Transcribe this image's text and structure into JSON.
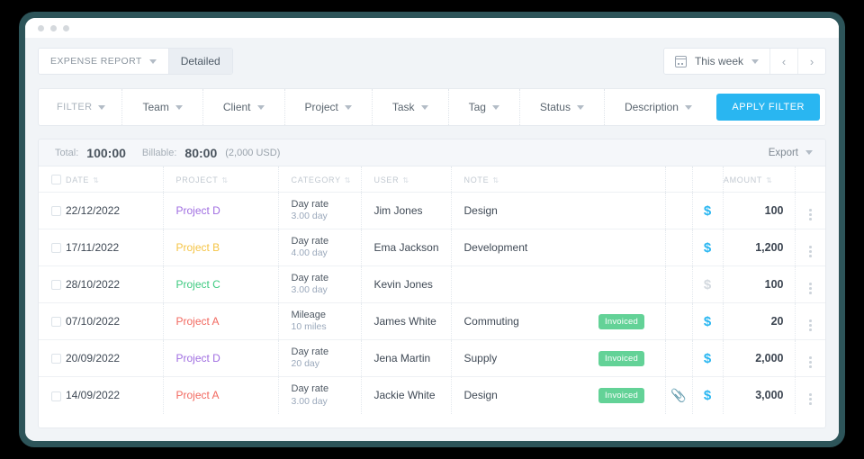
{
  "window": {
    "traffic_dots": 3
  },
  "topbar": {
    "report_type": "EXPENSE REPORT",
    "view_tab": "Detailed",
    "date_range": "This week",
    "prev_label": "‹",
    "next_label": "›",
    "calendar_icon": "calendar-icon"
  },
  "filterbar": {
    "items": [
      {
        "label": "FILTER"
      },
      {
        "label": "Team"
      },
      {
        "label": "Client"
      },
      {
        "label": "Project"
      },
      {
        "label": "Task"
      },
      {
        "label": "Tag"
      },
      {
        "label": "Status"
      },
      {
        "label": "Description"
      }
    ],
    "apply_label": "APPLY FILTER",
    "apply_color": "#29b6f1"
  },
  "totals": {
    "total_label": "Total:",
    "total_value": "100:00",
    "billable_label": "Billable:",
    "billable_value": "80:00",
    "currency_note": "(2,000 USD)",
    "export_label": "Export"
  },
  "table": {
    "columns": [
      {
        "key": "date",
        "label": "DATE",
        "sortable": true
      },
      {
        "key": "project",
        "label": "PROJECT",
        "sortable": true
      },
      {
        "key": "category",
        "label": "CATEGORY",
        "sortable": true
      },
      {
        "key": "user",
        "label": "USER",
        "sortable": true
      },
      {
        "key": "note",
        "label": "NOTE",
        "sortable": true
      },
      {
        "key": "amount",
        "label": "AMOUNT",
        "sortable": true
      }
    ],
    "sort_glyph": "⇅",
    "rows": [
      {
        "date": "22/12/2022",
        "project": "Project D",
        "project_color": "#a06ee1",
        "category": "Day rate",
        "quantity": "3.00 day",
        "user": "Jim Jones",
        "note": "Design",
        "status": "",
        "attachment": false,
        "billable": true,
        "amount": "100"
      },
      {
        "date": "17/11/2022",
        "project": "Project B",
        "project_color": "#f5c445",
        "category": "Day rate",
        "quantity": "4.00 day",
        "user": "Ema Jackson",
        "note": "Development",
        "status": "",
        "attachment": false,
        "billable": true,
        "amount": "1,200"
      },
      {
        "date": "28/10/2022",
        "project": "Project C",
        "project_color": "#3cc97f",
        "category": "Day rate",
        "quantity": "3.00 day",
        "user": "Kevin Jones",
        "note": "",
        "status": "",
        "attachment": false,
        "billable": false,
        "amount": "100"
      },
      {
        "date": "07/10/2022",
        "project": "Project A",
        "project_color": "#f2685f",
        "category": "Mileage",
        "quantity": "10 miles",
        "user": "James White",
        "note": "Commuting",
        "status": "Invoiced",
        "attachment": false,
        "billable": true,
        "amount": "20"
      },
      {
        "date": "20/09/2022",
        "project": "Project D",
        "project_color": "#a06ee1",
        "category": "Day rate",
        "quantity": "20 day",
        "user": "Jena Martin",
        "note": "Supply",
        "status": "Invoiced",
        "attachment": false,
        "billable": true,
        "amount": "2,000"
      },
      {
        "date": "14/09/2022",
        "project": "Project A",
        "project_color": "#f2685f",
        "category": "Day rate",
        "quantity": "3.00 day",
        "user": "Jackie White",
        "note": "Design",
        "status": "Invoiced",
        "attachment": true,
        "billable": true,
        "amount": "3,000"
      }
    ],
    "badge_color": "#63d297",
    "billable_icon": "dollar-icon",
    "attachment_icon": "paperclip-icon",
    "menu_icon": "kebab-menu-icon"
  }
}
